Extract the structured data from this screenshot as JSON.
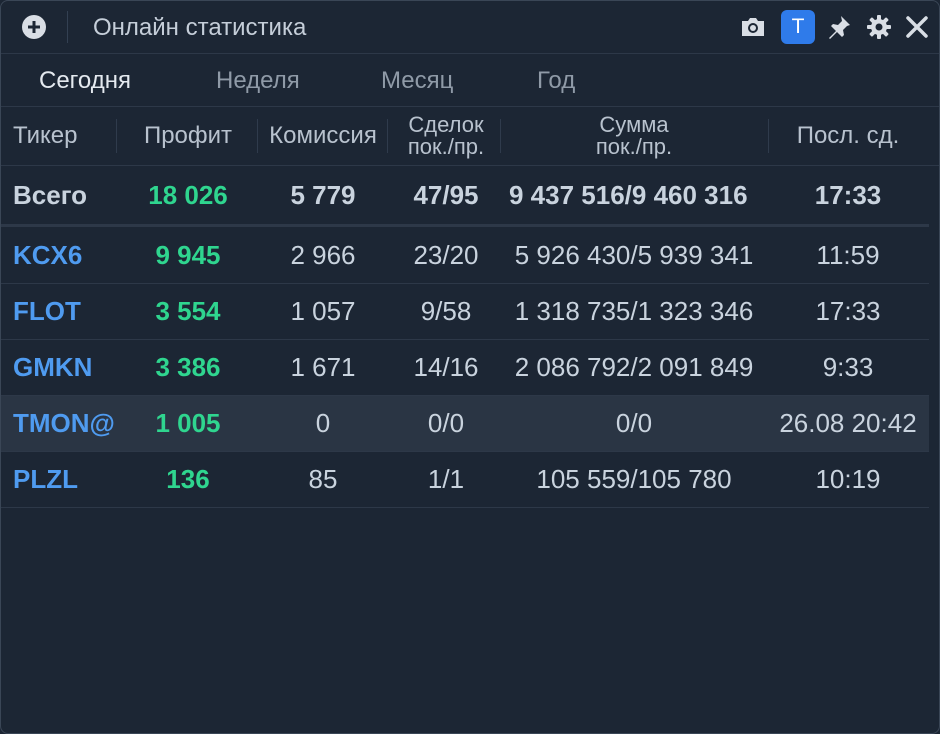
{
  "window": {
    "title": "Онлайн статистика"
  },
  "icons": {
    "add": "plus-circle-icon",
    "camera": "camera-icon",
    "badge": "T",
    "pin": "pin-icon",
    "settings": "gear-icon",
    "close": "close-icon"
  },
  "tabs": [
    {
      "label": "Сегодня",
      "active": true
    },
    {
      "label": "Неделя"
    },
    {
      "label": "Месяц"
    },
    {
      "label": "Год"
    }
  ],
  "columns": {
    "ticker": "Тикер",
    "profit": "Профит",
    "commission": "Комиссия",
    "deals_1": "Сделок",
    "deals_2": "пок./пр.",
    "sum_1": "Сумма",
    "sum_2": "пок./пр.",
    "last": "Посл. сд."
  },
  "total": {
    "ticker": "Всего",
    "profit": "18 026",
    "commission": "5 779",
    "deals": "47/95",
    "sum": "9 437 516/9 460 316",
    "last": "17:33"
  },
  "rows": [
    {
      "ticker": "KCX6",
      "profit": "9 945",
      "commission": "2 966",
      "deals": "23/20",
      "sum": "5 926 430/5 939 341",
      "last": "11:59"
    },
    {
      "ticker": "FLOT",
      "profit": "3 554",
      "commission": "1 057",
      "deals": "9/58",
      "sum": "1 318 735/1 323 346",
      "last": "17:33"
    },
    {
      "ticker": "GMKN",
      "profit": "3 386",
      "commission": "1 671",
      "deals": "14/16",
      "sum": "2 086 792/2 091 849",
      "last": "9:33"
    },
    {
      "ticker": "TMON@",
      "profit": "1 005",
      "commission": "0",
      "deals": "0/0",
      "sum": "0/0",
      "last": "26.08 20:42",
      "selected": true
    },
    {
      "ticker": "PLZL",
      "profit": "136",
      "commission": "85",
      "deals": "1/1",
      "sum": "105 559/105 780",
      "last": "10:19"
    }
  ],
  "colors": {
    "background": "#1c2634",
    "accent": "#2f7bea",
    "ticker": "#4f9bf0",
    "profit": "#2fd58f",
    "selected_row": "#2a3544"
  }
}
